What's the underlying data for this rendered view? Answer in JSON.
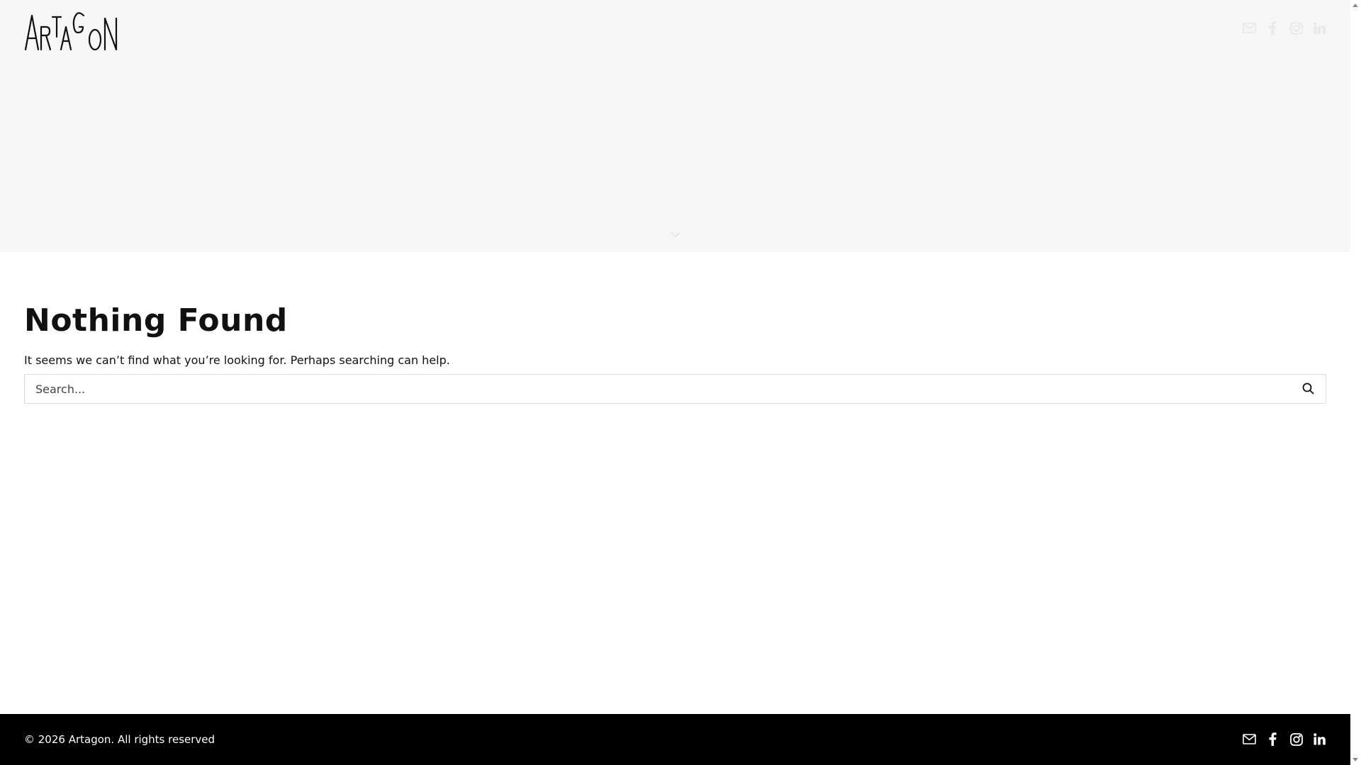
{
  "header": {
    "logo_text": "ARTAGON",
    "social_icons": [
      "email-icon",
      "facebook-icon",
      "instagram-icon",
      "linkedin-icon"
    ]
  },
  "main": {
    "title": "Nothing Found",
    "message": "It seems we can’t find what you’re looking for. Perhaps searching can help.",
    "search": {
      "placeholder": "Search...",
      "value": ""
    }
  },
  "footer": {
    "copyright": "© 2026 Artagon. All rights reserved",
    "social_icons": [
      "email-icon",
      "facebook-icon",
      "instagram-icon",
      "linkedin-icon"
    ]
  },
  "colors": {
    "hero_background": "#f6f6f6",
    "footer_background": "#000000",
    "text": "#111111"
  }
}
